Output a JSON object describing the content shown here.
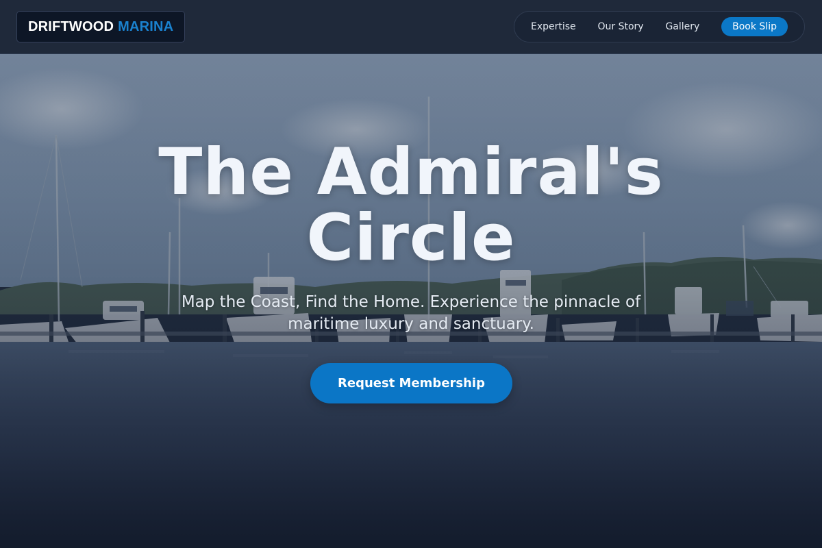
{
  "header": {
    "logo": {
      "primary": "DRIFTWOOD",
      "accent": "MARINA"
    },
    "nav": {
      "items": [
        {
          "label": "Expertise"
        },
        {
          "label": "Our Story"
        },
        {
          "label": "Gallery"
        }
      ],
      "cta_label": "Book Slip"
    }
  },
  "hero": {
    "title_line1": "The Admiral's",
    "title_line2": "Circle",
    "subtitle_line1": "Map the Coast, Find the Home. Experience the pinnacle of",
    "subtitle_line2": "maritime luxury and sanctuary.",
    "cta_label": "Request Membership"
  },
  "colors": {
    "accent": "#0b78c7",
    "logo_accent": "#1a82cf",
    "header_bg": "#1f293a",
    "title": "#f1f5fb"
  }
}
